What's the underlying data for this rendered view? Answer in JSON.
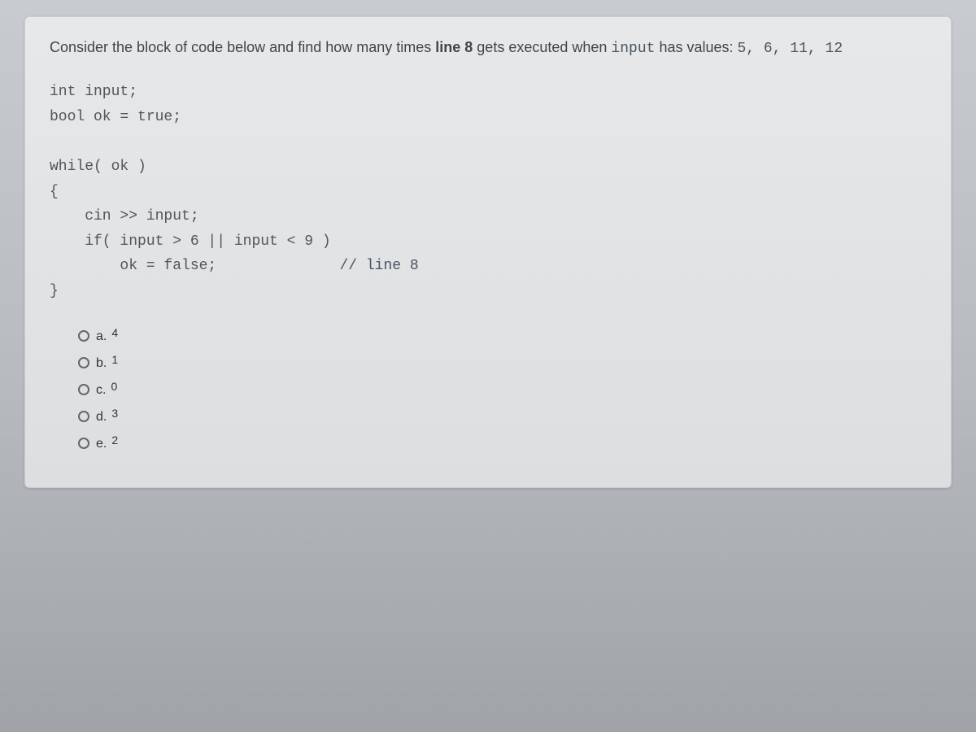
{
  "question": {
    "intro": "Consider the block of code below and find how many times ",
    "bold_part": "line 8",
    "mid": " gets executed when ",
    "code_word": "input",
    "after": " has values: ",
    "values": "5,  6,  11,  12"
  },
  "code": {
    "line1": "int input;",
    "line2": "bool ok = true;",
    "line3": "",
    "line4": "while( ok )",
    "line5": "{",
    "line6": "    cin >> input;",
    "line7": "    if( input > 6 || input < 9 )",
    "line8a": "        ok = false;",
    "line8b": "              // line 8",
    "line9": "}"
  },
  "answers": [
    {
      "letter": "a.",
      "value": "4"
    },
    {
      "letter": "b.",
      "value": "1"
    },
    {
      "letter": "c.",
      "value": "0"
    },
    {
      "letter": "d.",
      "value": "3"
    },
    {
      "letter": "e.",
      "value": "2"
    }
  ]
}
